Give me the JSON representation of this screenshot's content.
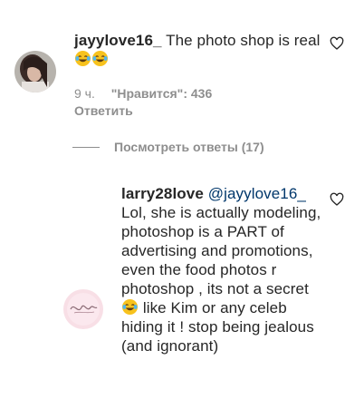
{
  "comments": [
    {
      "username": "jayylove16_",
      "text_before": "The photo shop is real",
      "emojis": [
        "face-with-tears-of-joy",
        "face-with-tears-of-joy"
      ],
      "time": "9 ч.",
      "likes": "\"Нравится\": 436",
      "reply": "Ответить"
    }
  ],
  "replies_toggle": "Посмотреть ответы (17)",
  "reply_comment": {
    "username": "larry28love",
    "mention": "@jayylove16_",
    "text_part1": "Lol, she is actually modeling, photoshop is a PART of advertising and promotions, even the food photos r photoshop , its not a secret",
    "emoji": "face-with-tears-of-joy",
    "text_part2": "like Kim or any celeb hiding it ! stop being jealous (and ignorant)"
  },
  "colors": {
    "text": "#262626",
    "secondary": "#8e8e8e",
    "mention": "#00376b",
    "emoji_face": "#f7c21d"
  }
}
